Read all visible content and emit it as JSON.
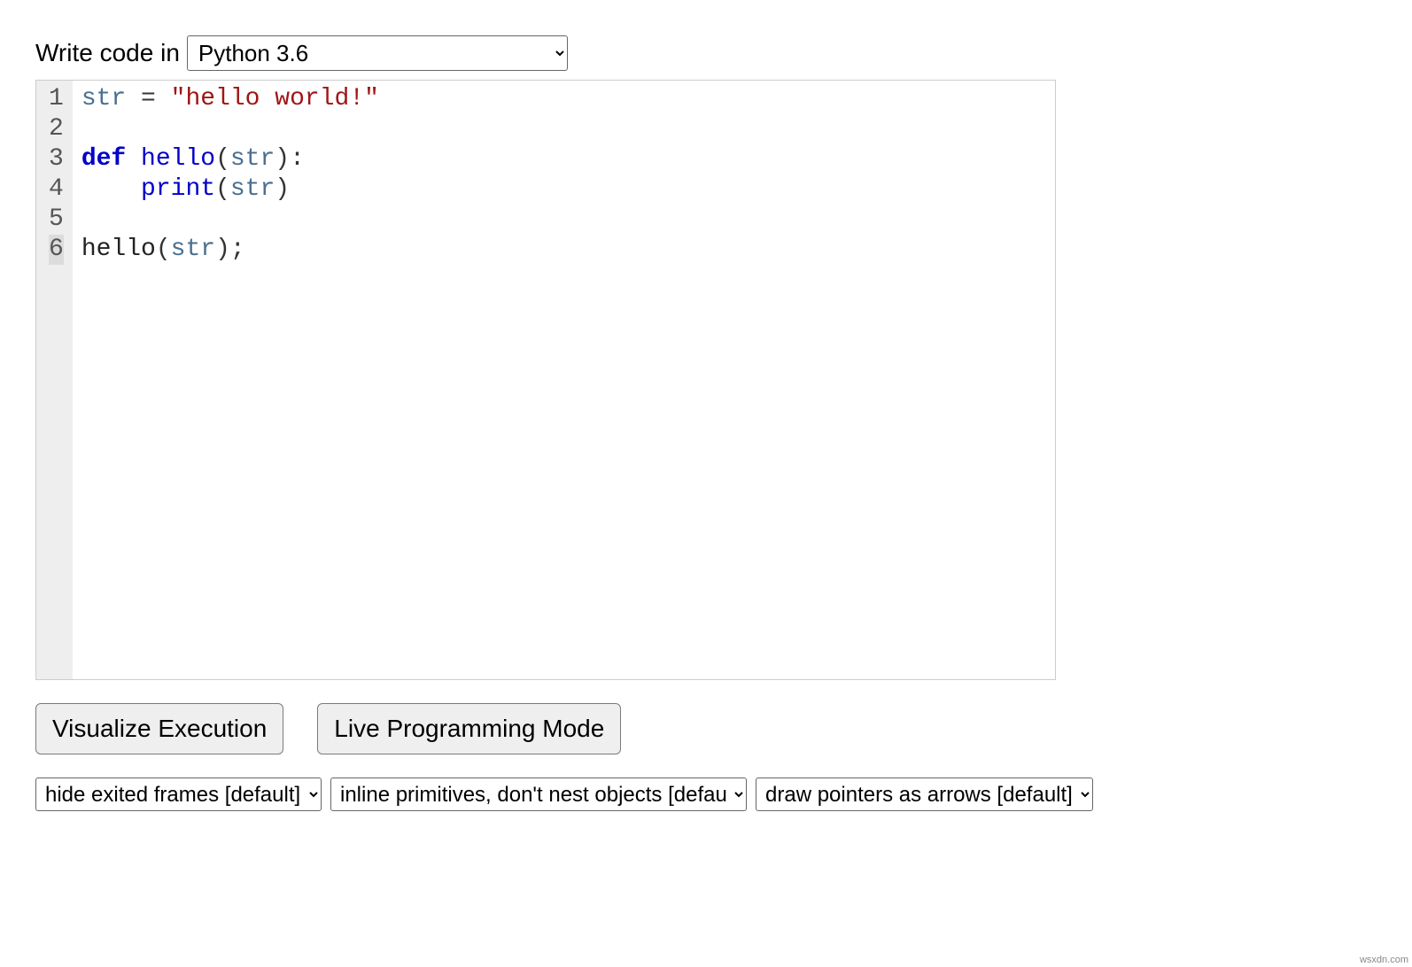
{
  "header": {
    "label": "Write code in",
    "language_selected": "Python 3.6"
  },
  "code": {
    "lines": [
      {
        "num": "1",
        "tokens": [
          {
            "t": "str",
            "c": "tok-builtin"
          },
          {
            "t": " ",
            "c": ""
          },
          {
            "t": "=",
            "c": "tok-op"
          },
          {
            "t": " ",
            "c": ""
          },
          {
            "t": "\"hello world!\"",
            "c": "tok-string"
          }
        ]
      },
      {
        "num": "2",
        "tokens": []
      },
      {
        "num": "3",
        "tokens": [
          {
            "t": "def",
            "c": "tok-keyword"
          },
          {
            "t": " ",
            "c": ""
          },
          {
            "t": "hello",
            "c": "tok-def"
          },
          {
            "t": "(",
            "c": "tok-op"
          },
          {
            "t": "str",
            "c": "tok-builtin"
          },
          {
            "t": "):",
            "c": "tok-op"
          }
        ]
      },
      {
        "num": "4",
        "tokens": [
          {
            "t": "    ",
            "c": ""
          },
          {
            "t": "print",
            "c": "tok-def"
          },
          {
            "t": "(",
            "c": "tok-op"
          },
          {
            "t": "str",
            "c": "tok-builtin"
          },
          {
            "t": ")",
            "c": "tok-op"
          }
        ]
      },
      {
        "num": "5",
        "tokens": []
      },
      {
        "num": "6",
        "active": true,
        "tokens": [
          {
            "t": "hello",
            "c": "tok-ident"
          },
          {
            "t": "(",
            "c": "tok-op"
          },
          {
            "t": "str",
            "c": "tok-builtin"
          },
          {
            "t": ");",
            "c": "tok-op"
          }
        ]
      }
    ]
  },
  "buttons": {
    "visualize": "Visualize Execution",
    "live": "Live Programming Mode"
  },
  "options": {
    "frames": "hide exited frames [default]",
    "primitives": "inline primitives, don't nest objects [default]",
    "pointers": "draw pointers as arrows [default]"
  },
  "footer": "wsxdn.com"
}
